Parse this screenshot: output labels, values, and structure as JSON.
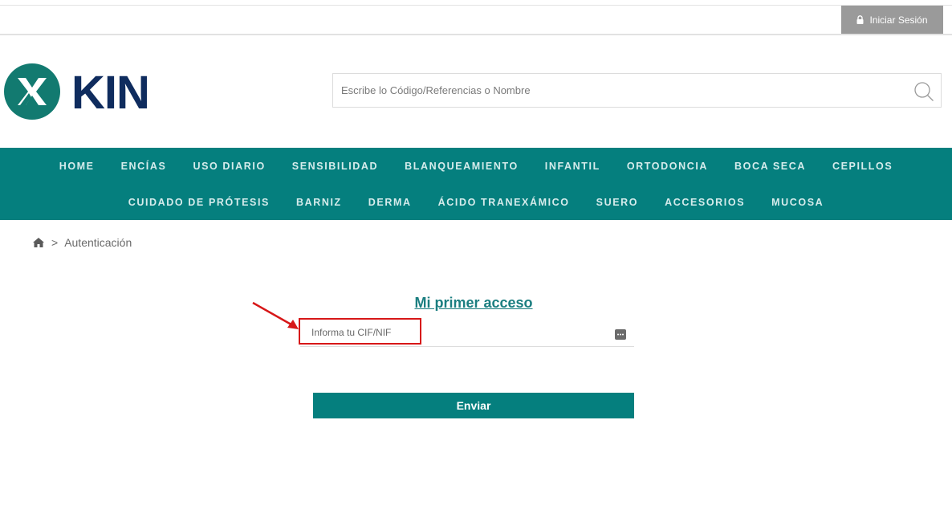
{
  "header": {
    "login_label": "Iniciar Sesión",
    "search_placeholder": "Escribe lo Código/Referencias o Nombre",
    "logo_text": "KIN"
  },
  "nav": {
    "row1": [
      "HOME",
      "ENCÍAS",
      "USO DIARIO",
      "SENSIBILIDAD",
      "BLANQUEAMIENTO",
      "INFANTIL",
      "ORTODONCIA",
      "BOCA SECA",
      "CEPILLOS"
    ],
    "row2": [
      "CUIDADO DE PRÓTESIS",
      "BARNIZ",
      "DERMA",
      "ÁCIDO TRANEXÁMICO",
      "SUERO",
      "ACCESORIOS",
      "MUCOSA"
    ]
  },
  "breadcrumb": {
    "separator": ">",
    "current": "Autenticación"
  },
  "form": {
    "title": "Mi primer acceso",
    "cif_placeholder": "Informa tu CIF/NIF",
    "submit_label": "Enviar"
  },
  "colors": {
    "brand_teal": "#057f7e",
    "logo_navy": "#0f2c5e",
    "highlight_red": "#d71718"
  }
}
